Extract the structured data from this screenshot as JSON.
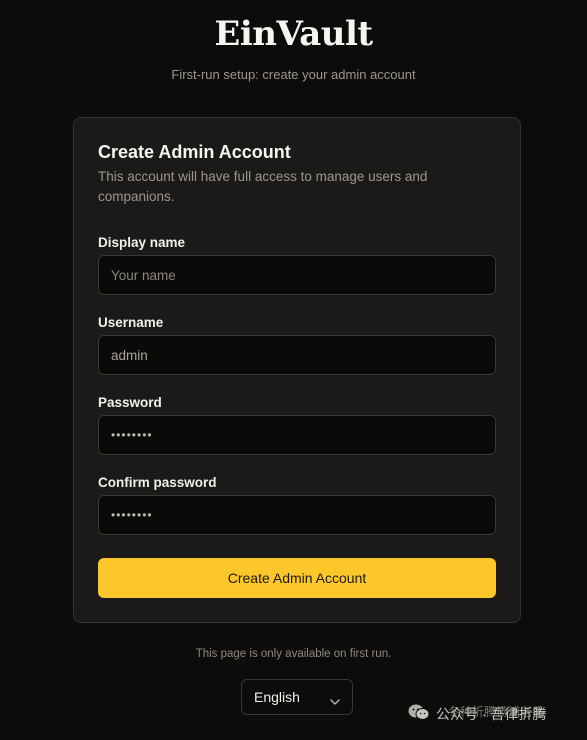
{
  "app": {
    "logo": "EinVault",
    "tagline": "First-run setup: create your admin account"
  },
  "card": {
    "title": "Create Admin Account",
    "description": "This account will have full access to manage users and companions."
  },
  "form": {
    "display_name": {
      "label": "Display name",
      "placeholder": "Your name",
      "value": ""
    },
    "username": {
      "label": "Username",
      "value": "admin"
    },
    "password": {
      "label": "Password",
      "value": "••••••••"
    },
    "confirm_password": {
      "label": "Confirm password",
      "value": "••••••••"
    },
    "submit_label": "Create Admin Account"
  },
  "footer": {
    "note": "This page is only available on first run.",
    "language": {
      "selected": "English"
    }
  },
  "watermark": {
    "text": "公众号 · 吾律折腾",
    "subtext": "冬种折腾杨浦老番"
  },
  "colors": {
    "background": "#0d0c0b",
    "card": "#1c1a18",
    "accent": "#fcc72a"
  }
}
